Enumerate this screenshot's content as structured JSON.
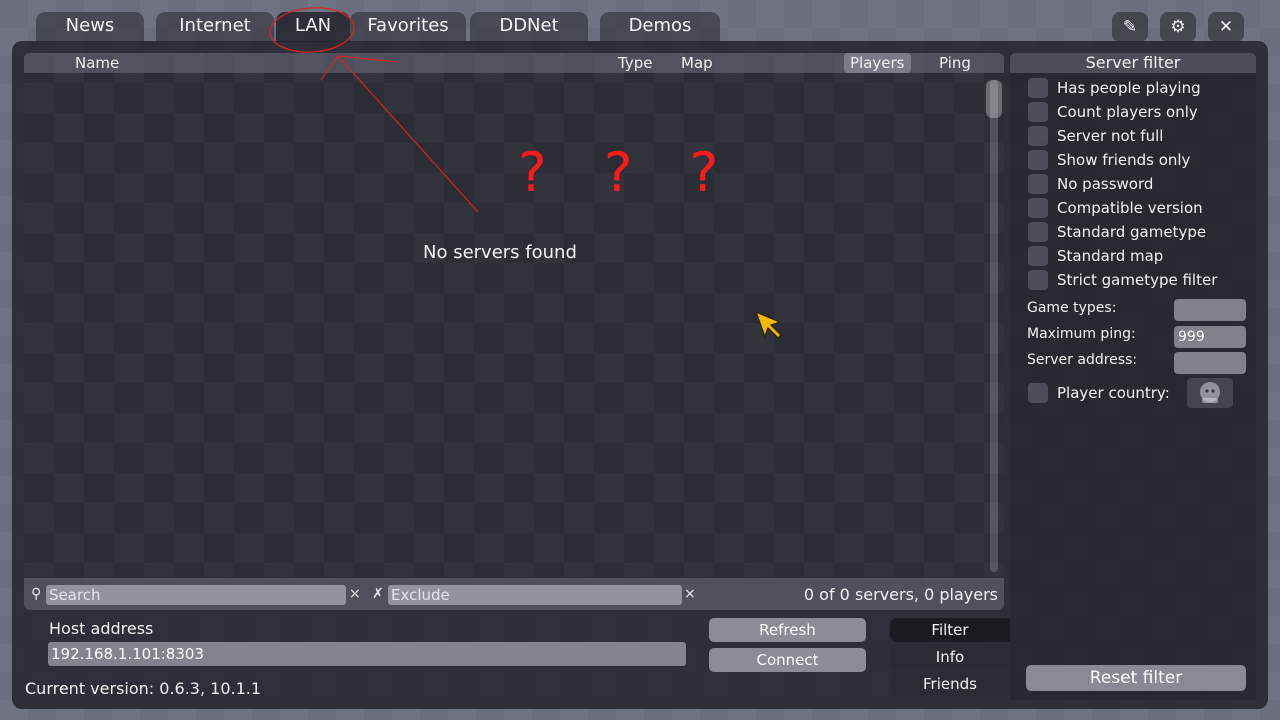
{
  "tabs": [
    {
      "label": "News"
    },
    {
      "label": "Internet"
    },
    {
      "label": "LAN"
    },
    {
      "label": "Favorites"
    },
    {
      "label": "DDNet"
    },
    {
      "label": "Demos"
    }
  ],
  "active_tab": "LAN",
  "top_icons": [
    {
      "name": "edit-icon",
      "glyph": "✎"
    },
    {
      "name": "settings-icon",
      "glyph": "⚙"
    },
    {
      "name": "close-icon",
      "glyph": "✕"
    }
  ],
  "server_list": {
    "columns": [
      "Name",
      "Type",
      "Map",
      "Players",
      "Ping"
    ],
    "sorted_column": "Players",
    "empty_message": "No servers found",
    "annotation_text": "? ? ?"
  },
  "search": {
    "search_icon": "⚲",
    "search_placeholder": "Search",
    "exclude_icon": "✗",
    "exclude_placeholder": "Exclude",
    "clear_glyph": "×",
    "status": "0 of 0 servers, 0 players"
  },
  "connect_area": {
    "host_label": "Host address",
    "host_value": "192.168.1.101:8303",
    "refresh_label": "Refresh",
    "connect_label": "Connect",
    "version_text": "Current version: 0.6.3, 10.1.1"
  },
  "side_tabs": [
    "Filter",
    "Info",
    "Friends"
  ],
  "active_side_tab": "Filter",
  "filter": {
    "title": "Server filter",
    "checkboxes": [
      "Has people playing",
      "Count players only",
      "Server not full",
      "Show friends only",
      "No password",
      "Compatible version",
      "Standard gametype",
      "Standard map",
      "Strict gametype filter"
    ],
    "game_types_label": "Game types:",
    "game_types_value": "",
    "max_ping_label": "Maximum ping:",
    "max_ping_value": "999",
    "server_address_label": "Server address:",
    "server_address_value": "",
    "player_country_label": "Player country:",
    "reset_label": "Reset filter"
  },
  "colors": {
    "annotation_red": "#ff1a1a",
    "cursor_yellow": "#f5b800"
  }
}
